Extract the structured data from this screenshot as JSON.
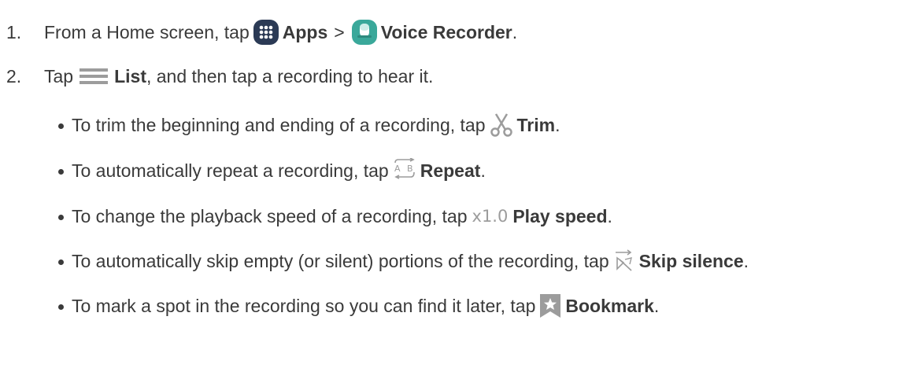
{
  "steps": [
    {
      "number": "1.",
      "prefix": "From a Home screen, tap",
      "item1": "Apps",
      "separator": ">",
      "item2": "Voice Recorder",
      "suffix": ".",
      "icons": [
        "apps-icon",
        "voice-recorder-icon"
      ]
    },
    {
      "number": "2.",
      "prefix": "Tap",
      "item1": "List",
      "suffix": ", and then tap a recording to hear it.",
      "icons": [
        "list-icon"
      ]
    }
  ],
  "bullets": [
    {
      "text": "To trim the beginning and ending of a recording, tap",
      "label": "Trim",
      "suffix": ".",
      "icon": "scissors-icon"
    },
    {
      "text": "To automatically repeat a recording, tap",
      "label": "Repeat",
      "suffix": ".",
      "icon": "repeat-ab-icon"
    },
    {
      "text": "To change the playback speed of a recording, tap",
      "icon_text": "x1.0",
      "label": "Play speed",
      "suffix": ".",
      "icon": "play-speed-icon"
    },
    {
      "text": "To automatically skip empty (or silent) portions of the recording, tap",
      "label": "Skip silence",
      "suffix": ".",
      "icon": "skip-silence-icon"
    },
    {
      "text": "To mark a spot in the recording so you can find it later, tap",
      "label": "Bookmark",
      "suffix": ".",
      "icon": "bookmark-icon"
    }
  ],
  "colors": {
    "text": "#3a3a3a",
    "apps_icon": "#2b3a55",
    "voice_recorder_icon": "#3aa89a",
    "icon_gray": "#9c9c9c"
  }
}
